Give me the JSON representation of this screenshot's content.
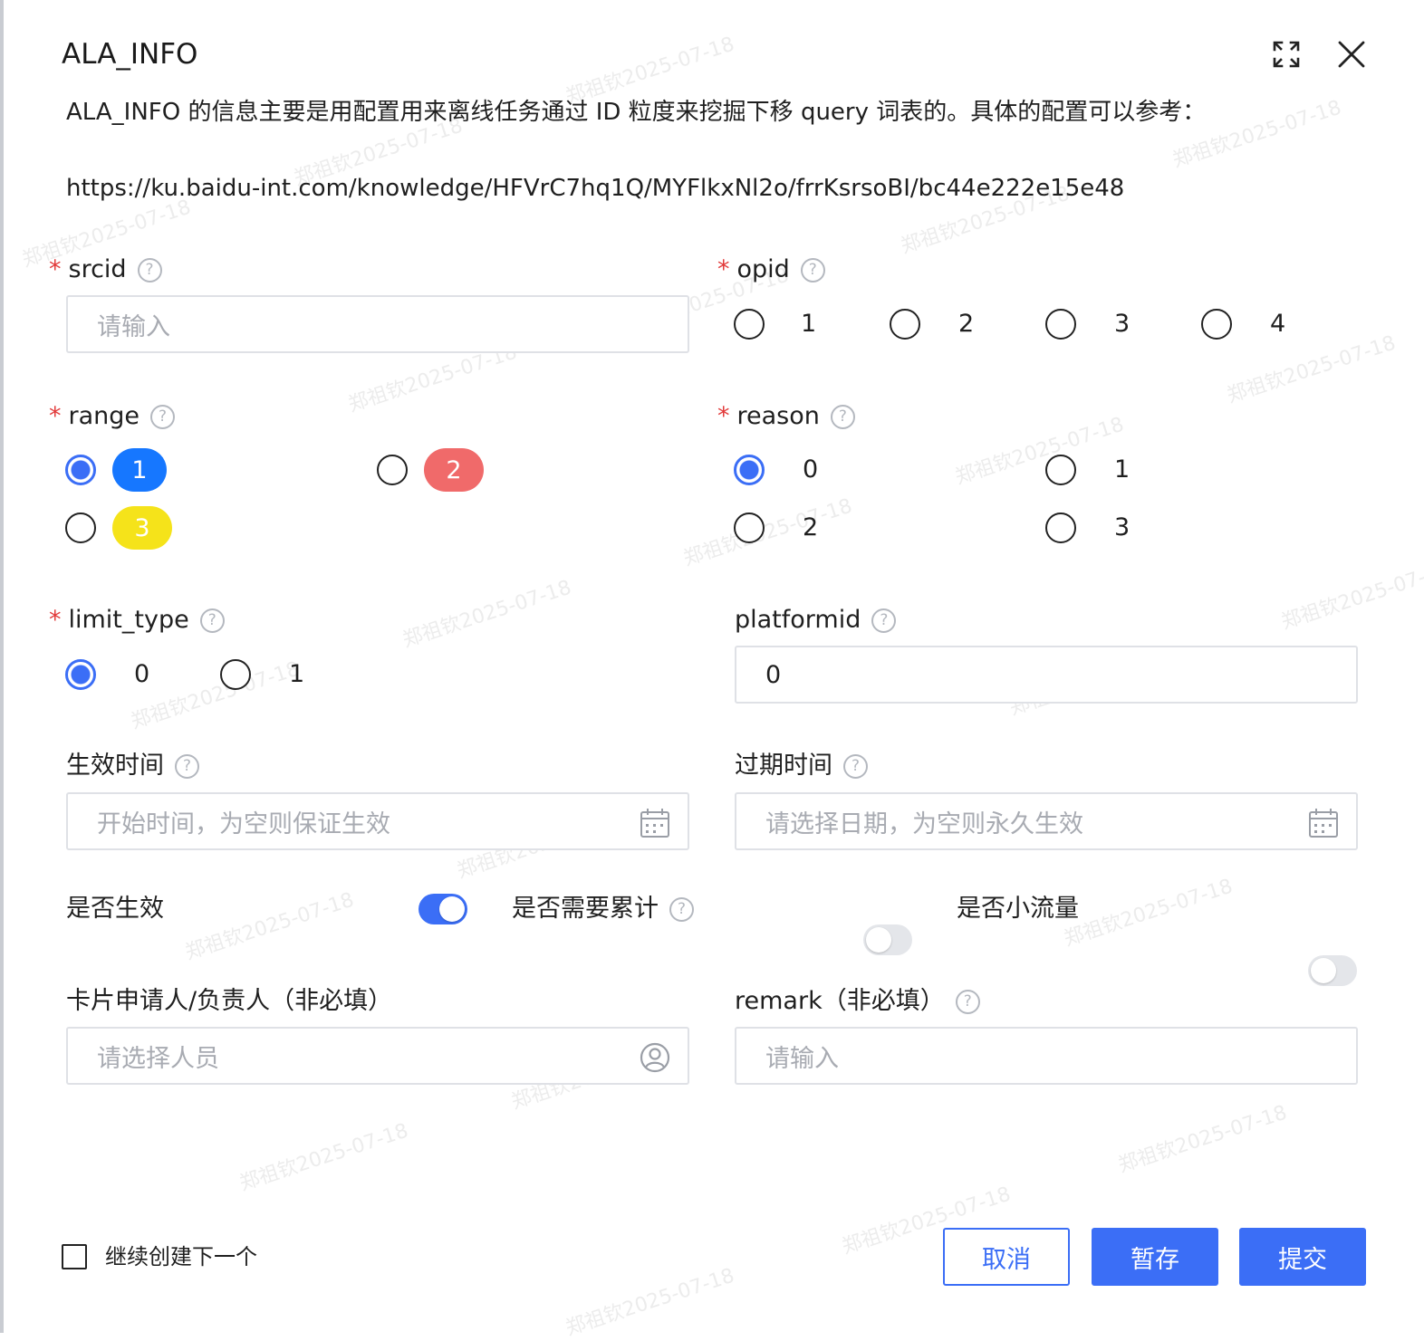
{
  "dialog": {
    "title": "ALA_INFO",
    "fullscreen_icon": "fullscreen-icon",
    "close_icon": "close-icon",
    "description_line1": "ALA_INFO 的信息主要是用配置用来离线任务通过 ID 粒度来挖掘下移 query 词表的。具体的配置可以参考：",
    "description_line2": "https://ku.baidu-int.com/knowledge/HFVrC7hq1Q/MYFlkxNl2o/frrKsrsoBI/bc44e222e15e48"
  },
  "help_glyph": "?",
  "required_mark": "*",
  "form": {
    "srcid": {
      "label": "srcid",
      "placeholder": "请输入"
    },
    "opid": {
      "label": "opid",
      "options": [
        "1",
        "2",
        "3",
        "4"
      ],
      "selected": null
    },
    "range": {
      "label": "range",
      "options": [
        {
          "label": "1",
          "color": "#1677ff"
        },
        {
          "label": "2",
          "color": "#f06a6a"
        },
        {
          "label": "3",
          "color": "#f5e31a"
        }
      ],
      "selected": "1"
    },
    "reason": {
      "label": "reason",
      "options": [
        "0",
        "1",
        "2",
        "3"
      ],
      "selected": "0"
    },
    "limit_type": {
      "label": "limit_type",
      "options": [
        "0",
        "1"
      ],
      "selected": "0"
    },
    "platformid": {
      "label": "platformid",
      "value": "0"
    },
    "start_time": {
      "label": "生效时间",
      "placeholder": "开始时间，为空则保证生效",
      "icon": "calendar-icon"
    },
    "expire_time": {
      "label": "过期时间",
      "placeholder": "请选择日期，为空则永久生效",
      "icon": "calendar-icon"
    },
    "is_effective": {
      "label": "是否生效",
      "on": true
    },
    "need_accumulate": {
      "label": "是否需要累计",
      "on": false
    },
    "small_traffic": {
      "label": "是否小流量",
      "on": false
    },
    "owner": {
      "label": "卡片申请人/负责人（非必填）",
      "placeholder": "请选择人员",
      "icon": "user-icon"
    },
    "remark": {
      "label": "remark（非必填）",
      "placeholder": "请输入"
    }
  },
  "footer": {
    "continue_label": "继续创建下一个",
    "cancel": "取消",
    "save_draft": "暂存",
    "submit": "提交"
  },
  "colors": {
    "primary": "#3b6ef6",
    "required": "#e23a3a"
  },
  "watermark": "郑祖钦2025-07-18"
}
